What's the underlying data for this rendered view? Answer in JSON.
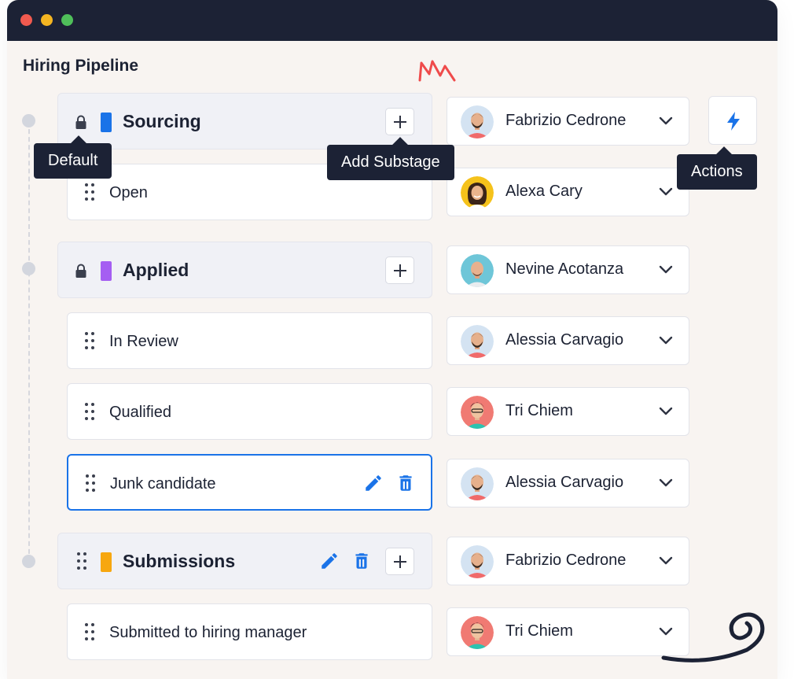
{
  "window": {
    "controls": [
      {
        "name": "close",
        "color": "#f05a4f"
      },
      {
        "name": "minimize",
        "color": "#f4b521"
      },
      {
        "name": "maximize",
        "color": "#4fbf5a"
      }
    ]
  },
  "page": {
    "title": "Hiring Pipeline"
  },
  "colors": {
    "sourcing": "#1a73e8",
    "applied": "#a55ef2",
    "submissions": "#f7a70f",
    "accent": "#1a73e8",
    "dark": "#1c2235"
  },
  "stages": {
    "sourcing": {
      "label": "Sourcing",
      "icon": "lock-icon",
      "assignee": "Fabrizio Cedrone"
    },
    "applied": {
      "label": "Applied",
      "icon": "lock-icon",
      "assignee": "Nevine Acotanza"
    },
    "submissions": {
      "label": "Submissions",
      "icon": "grip-icon",
      "assignee": "Fabrizio Cedrone"
    }
  },
  "substages": {
    "open": {
      "label": "Open",
      "assignee": "Alexa Cary"
    },
    "in_review": {
      "label": "In Review",
      "assignee": "Alessia Carvagio"
    },
    "qualified": {
      "label": "Qualified",
      "assignee": "Tri Chiem"
    },
    "junk": {
      "label": "Junk candidate",
      "assignee": "Alessia Carvagio"
    },
    "submitted": {
      "label": "Submitted to hiring manager",
      "assignee": "Tri Chiem"
    }
  },
  "tooltips": {
    "default": "Default",
    "add_substage": "Add Substage",
    "actions": "Actions"
  },
  "icons": {
    "add": "plus-icon",
    "edit": "pencil-icon",
    "delete": "trash-icon",
    "dropdown": "chevron-down-icon",
    "actions": "lightning-bolt-icon",
    "drag": "grip-icon"
  }
}
